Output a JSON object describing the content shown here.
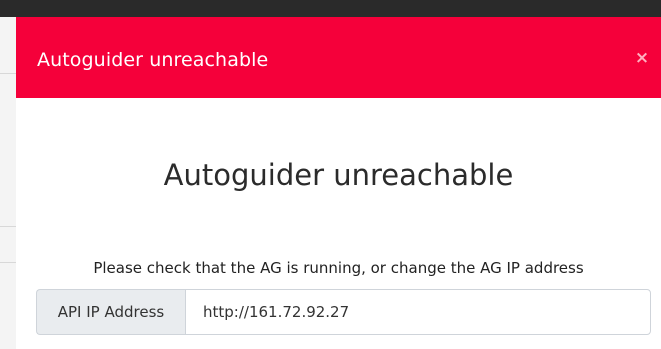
{
  "modal": {
    "header_title": "Autoguider unreachable",
    "close_symbol": "×",
    "heading": "Autoguider unreachable",
    "message": "Please check that the AG is running, or change the AG IP address",
    "ip_field": {
      "label": "API IP Address",
      "value": "http://161.72.92.27"
    }
  },
  "colors": {
    "header_bg": "#f5003a",
    "header_text": "#ffffff"
  },
  "icons": {
    "close": "close-icon"
  }
}
